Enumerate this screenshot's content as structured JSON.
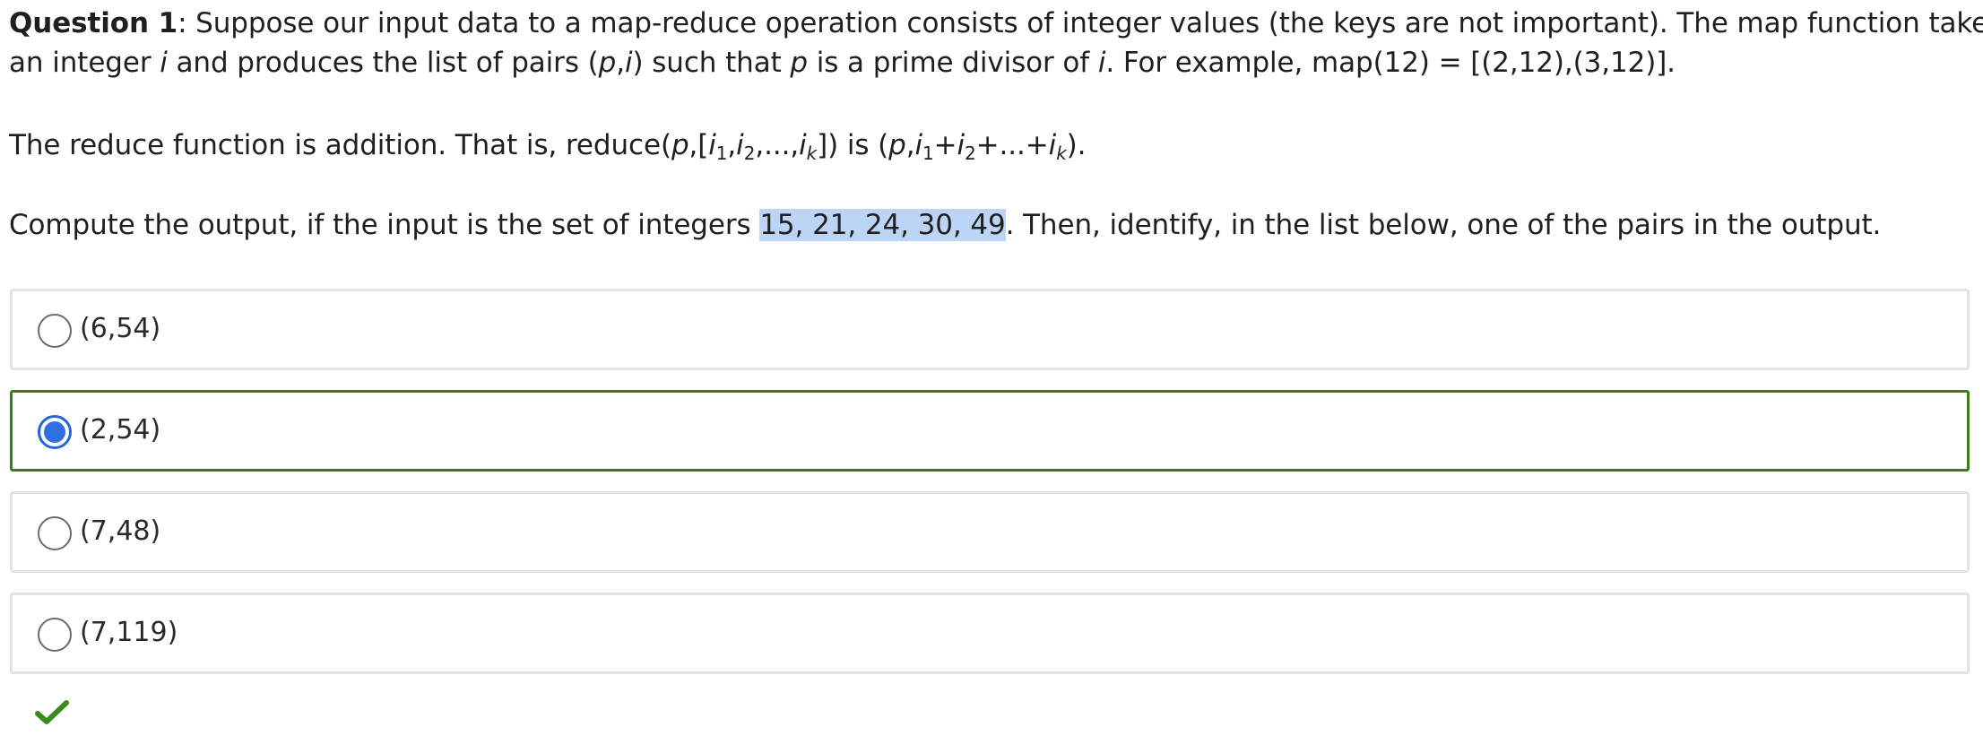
{
  "question": {
    "label": "Question 1",
    "line1": ": Suppose our input data to a map-reduce operation consists of integer values (the keys are not important). The map function takes",
    "line2_a": "an integer ",
    "line2_i": "i",
    "line2_b": " and produces the list of pairs (",
    "line2_p": "p",
    "line2_c": ",",
    "line2_i2": "i",
    "line2_d": ") such that ",
    "line2_p2": "p",
    "line2_e": " is a prime divisor of ",
    "line2_i3": "i",
    "line2_f": ". For example, map(12) = [(2,12),(3,12)].",
    "reduce_a": "The reduce function is addition. That is, reduce(",
    "reduce_p": "p",
    "reduce_b": ",[",
    "reduce_i1": "i",
    "reduce_s1": "1",
    "reduce_c1": ",",
    "reduce_i2": "i",
    "reduce_s2": "2",
    "reduce_c2": ",...,",
    "reduce_ik": "i",
    "reduce_sk": "k",
    "reduce_d": "]) is (",
    "reduce_p2": "p",
    "reduce_e": ",",
    "reduce_j1": "i",
    "reduce_t1": "1",
    "reduce_plus1": "+",
    "reduce_j2": "i",
    "reduce_t2": "2",
    "reduce_plus2": "+...+",
    "reduce_jk": "i",
    "reduce_tk": "k",
    "reduce_f": ").",
    "compute_a": "Compute the output, if the input is the set of integers ",
    "compute_highlight": "15, 21, 24, 30, 49",
    "compute_b": ". Then, identify, in the list below, one of the pairs in the output."
  },
  "options": [
    {
      "label": "(6,54)",
      "selected": false
    },
    {
      "label": "(2,54)",
      "selected": true
    },
    {
      "label": "(7,48)",
      "selected": false
    },
    {
      "label": "(7,119)",
      "selected": false
    }
  ],
  "colors": {
    "selected_border": "#3a7d1e",
    "radio_fill": "#2f6fe0",
    "highlight": "#bcd4f5",
    "check": "#3a8a1f"
  },
  "icons": {
    "correct": "checkmark-icon"
  }
}
